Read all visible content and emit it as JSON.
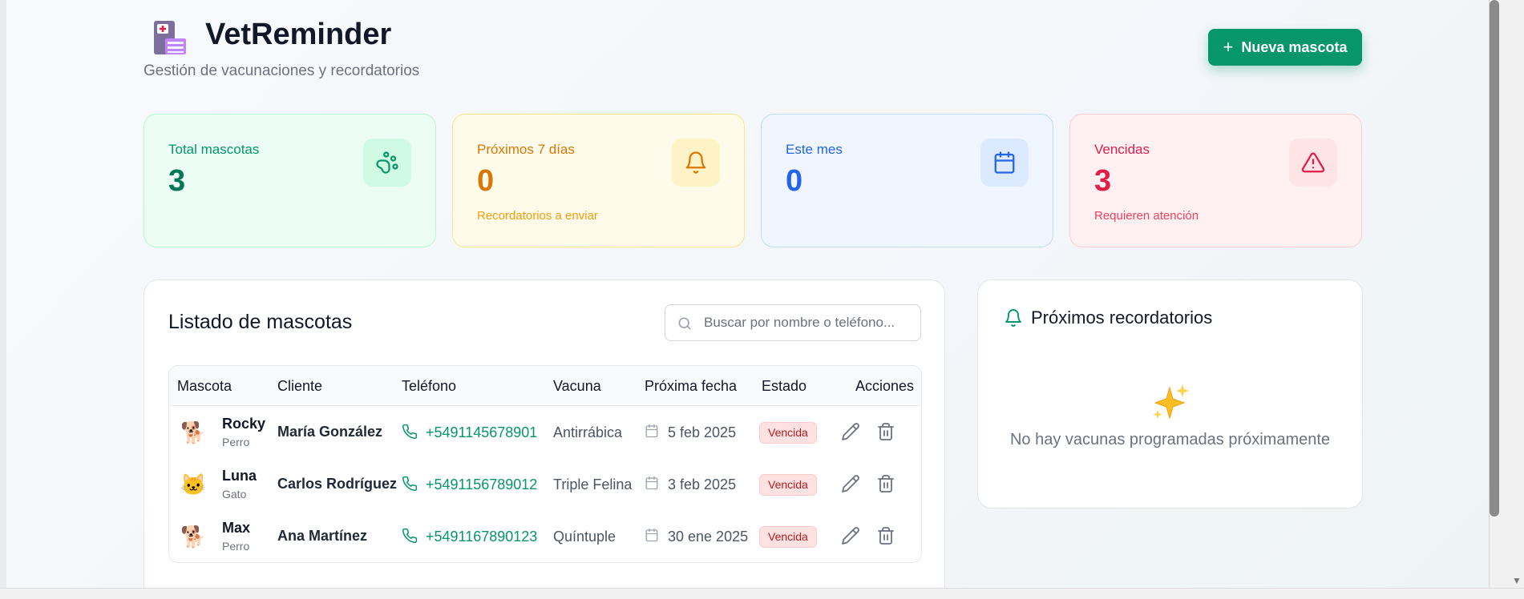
{
  "header": {
    "app_title": "VetReminder",
    "subtitle": "Gestión de vacunaciones y recordatorios",
    "new_button_label": "Nueva mascota",
    "new_button_plus": "+"
  },
  "stats": [
    {
      "label": "Total mascotas",
      "value": "3",
      "sub": "",
      "icon": "paw-icon"
    },
    {
      "label": "Próximos 7 días",
      "value": "0",
      "sub": "Recordatorios a enviar",
      "icon": "bell-icon"
    },
    {
      "label": "Este mes",
      "value": "0",
      "sub": "",
      "icon": "calendar-icon"
    },
    {
      "label": "Vencidas",
      "value": "3",
      "sub": "Requieren atención",
      "icon": "warning-icon"
    }
  ],
  "list": {
    "title": "Listado de mascotas",
    "search_placeholder": "Buscar por nombre o teléfono...",
    "columns": [
      "Mascota",
      "Cliente",
      "Teléfono",
      "Vacuna",
      "Próxima fecha",
      "Estado",
      "Acciones"
    ],
    "rows": [
      {
        "pet_icon": "🐕",
        "pet": "Rocky",
        "kind": "Perro",
        "client": "María González",
        "phone": "+5491145678901",
        "vaccine": "Antirrábica",
        "date": "5 feb 2025",
        "status": "Vencida"
      },
      {
        "pet_icon": "🐱",
        "pet": "Luna",
        "kind": "Gato",
        "client": "Carlos Rodríguez",
        "phone": "+5491156789012",
        "vaccine": "Triple Felina",
        "date": "3 feb 2025",
        "status": "Vencida"
      },
      {
        "pet_icon": "🐕",
        "pet": "Max",
        "kind": "Perro",
        "client": "Ana Martínez",
        "phone": "+5491167890123",
        "vaccine": "Quíntuple",
        "date": "30 ene 2025",
        "status": "Vencida"
      }
    ]
  },
  "reminders": {
    "title": "Próximos recordatorios",
    "empty_text": "No hay vacunas programadas próximamente"
  },
  "colors": {
    "accent": "#059669",
    "danger": "#e11d48",
    "warning": "#d97706",
    "info": "#2563eb"
  }
}
